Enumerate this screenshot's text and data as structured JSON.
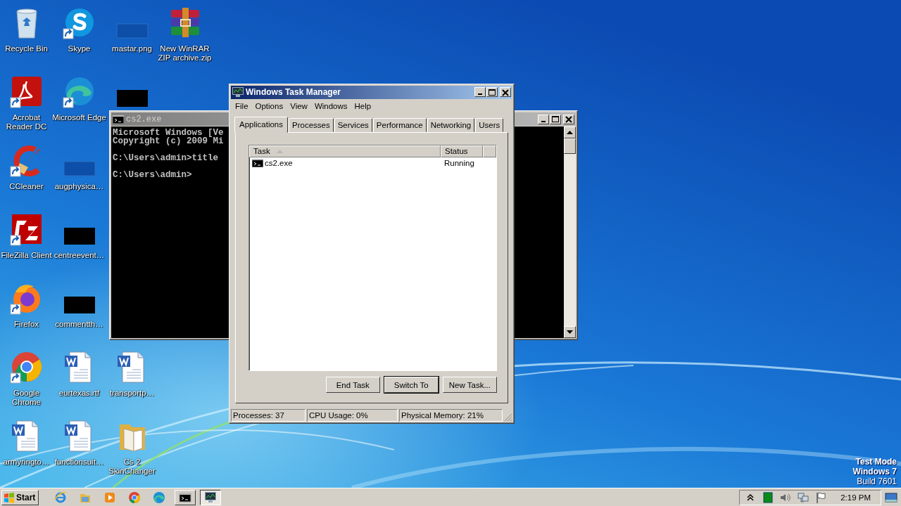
{
  "desktop": {
    "icon_columns": [
      [
        {
          "kind": "recycle",
          "label": "Recycle Bin",
          "shortcut": false
        },
        {
          "kind": "acrobat",
          "label": "Acrobat Reader DC",
          "shortcut": true
        },
        {
          "kind": "ccleaner",
          "label": "CCleaner",
          "shortcut": true
        },
        {
          "kind": "filezilla",
          "label": "FileZilla Client",
          "shortcut": true
        },
        {
          "kind": "firefox",
          "label": "Firefox",
          "shortcut": true
        },
        {
          "kind": "chrome",
          "label": "Google Chrome",
          "shortcut": true
        },
        {
          "kind": "word",
          "label": "armyringto…",
          "shortcut": false
        }
      ],
      [
        {
          "kind": "skype",
          "label": "Skype",
          "shortcut": true
        },
        {
          "kind": "edge",
          "label": "Microsoft Edge",
          "shortcut": true
        },
        {
          "kind": "thumb-blue",
          "label": "augphysica…",
          "shortcut": false
        },
        {
          "kind": "thumb-black",
          "label": "centreevent…",
          "shortcut": false
        },
        {
          "kind": "thumb-black",
          "label": "commentth…",
          "shortcut": false
        },
        {
          "kind": "word",
          "label": "eurtexas.rtf",
          "shortcut": false
        },
        {
          "kind": "word",
          "label": "functionsuit…",
          "shortcut": false
        }
      ],
      [
        {
          "kind": "thumb-blue",
          "label": "mastar.png",
          "shortcut": false
        },
        {
          "kind": "thumb-black",
          "shortcut": false
        },
        {
          "kind": "covered"
        },
        {
          "kind": "covered"
        },
        {
          "kind": "covered"
        },
        {
          "kind": "word",
          "label": "transportp…",
          "shortcut": false
        },
        {
          "kind": "folder",
          "label": "Cs 2 SkinChanger",
          "shortcut": false
        }
      ],
      [
        {
          "kind": "winrar",
          "label": "New WinRAR ZIP archive.zip",
          "shortcut": false
        }
      ]
    ],
    "notice": [
      "Test Mode",
      "Windows 7",
      "Build 7601"
    ]
  },
  "console_window": {
    "title": "cs2.exe",
    "active": false,
    "lines": [
      {
        "text": "Microsoft Windows [Ve",
        "gap_after": false
      },
      {
        "text": "Copyright (c) 2009 Mi",
        "gap_after": true
      },
      {
        "text": "C:\\Users\\admin>title",
        "gap_after": true
      },
      {
        "text": "C:\\Users\\admin>",
        "gap_after": false
      }
    ]
  },
  "task_manager": {
    "title": "Windows Task Manager",
    "active": true,
    "menu": [
      "File",
      "Options",
      "View",
      "Windows",
      "Help"
    ],
    "tabs": [
      {
        "label": "Applications",
        "selected": true
      },
      {
        "label": "Processes",
        "selected": false
      },
      {
        "label": "Services",
        "selected": false
      },
      {
        "label": "Performance",
        "selected": false
      },
      {
        "label": "Networking",
        "selected": false
      },
      {
        "label": "Users",
        "selected": false
      }
    ],
    "columns": [
      "Task",
      "Status"
    ],
    "rows": [
      {
        "task": "cs2.exe",
        "status": "Running",
        "selected": false
      }
    ],
    "buttons": [
      {
        "label": "End Task",
        "default": false
      },
      {
        "label": "Switch To",
        "default": true
      },
      {
        "label": "New Task...",
        "default": false
      }
    ],
    "status_bar": [
      "Processes: 37",
      "CPU Usage: 0%",
      "Physical Memory: 21%"
    ]
  },
  "taskbar": {
    "start": "Start",
    "quick_launch": [
      {
        "kind": "ie"
      },
      {
        "kind": "explorer"
      },
      {
        "kind": "media"
      },
      {
        "kind": "chrome"
      },
      {
        "kind": "edge"
      }
    ],
    "tasks": [
      {
        "kind": "console",
        "selected": false
      },
      {
        "kind": "taskmgr",
        "selected": true
      }
    ],
    "tray": [
      {
        "kind": "chevron"
      },
      {
        "kind": "green"
      },
      {
        "kind": "speaker"
      },
      {
        "kind": "network"
      },
      {
        "kind": "flag"
      }
    ],
    "clock": "2:19 PM"
  }
}
